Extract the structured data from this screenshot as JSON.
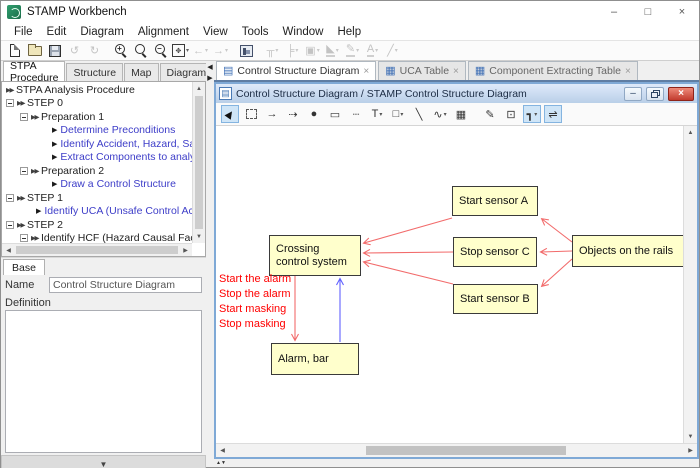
{
  "window": {
    "title": "STAMP Workbench"
  },
  "menubar": {
    "items": [
      "File",
      "Edit",
      "Diagram",
      "Alignment",
      "View",
      "Tools",
      "Window",
      "Help"
    ]
  },
  "left_panel": {
    "tabs": [
      "STPA Procedure",
      "Structure",
      "Map",
      "Diagram"
    ],
    "active_tab": "STPA Procedure",
    "tree": {
      "items": [
        {
          "label": "STPA Analysis Procedure"
        },
        {
          "label": "STEP 0"
        },
        {
          "label": "Preparation 1"
        },
        {
          "label": "Determine Preconditions"
        },
        {
          "label": "Identify Accident, Hazard, Safety Co"
        },
        {
          "label": "Extract Components to analyze"
        },
        {
          "label": "Preparation 2"
        },
        {
          "label": "Draw a Control Structure"
        },
        {
          "label": "STEP 1"
        },
        {
          "label": "Identify UCA (Unsafe Control Action)"
        },
        {
          "label": "STEP 2"
        },
        {
          "label": "Identify HCF (Hazard Causal Factor)"
        }
      ]
    },
    "base": {
      "tab_label": "Base",
      "name_label": "Name",
      "name_value": "Control Structure Diagram",
      "definition_label": "Definition",
      "definition_value": ""
    }
  },
  "editor": {
    "tabs": [
      {
        "label": "Control Structure Diagram"
      },
      {
        "label": "UCA Table"
      },
      {
        "label": "Component Extracting Table"
      }
    ],
    "active_tab": "Control Structure Diagram",
    "window_title": "Control Structure Diagram / STAMP Control Structure Diagram",
    "diagram": {
      "nodes": [
        {
          "id": "crossing-control-system",
          "label": "Crossing control system"
        },
        {
          "id": "alarm-bar",
          "label": "Alarm, bar"
        },
        {
          "id": "start-sensor-a",
          "label": "Start sensor A"
        },
        {
          "id": "stop-sensor-c",
          "label": "Stop sensor C"
        },
        {
          "id": "start-sensor-b",
          "label": "Start sensor B"
        },
        {
          "id": "objects-on-the-rails",
          "label": "Objects on the rails"
        }
      ],
      "control_action_labels": [
        "Start the alarm",
        "Stop the alarm",
        "Start masking",
        "Stop masking"
      ],
      "edges": [
        {
          "from": "objects-on-the-rails",
          "to": "start-sensor-a",
          "color": "red"
        },
        {
          "from": "objects-on-the-rails",
          "to": "stop-sensor-c",
          "color": "red"
        },
        {
          "from": "objects-on-the-rails",
          "to": "start-sensor-b",
          "color": "red"
        },
        {
          "from": "start-sensor-a",
          "to": "crossing-control-system",
          "color": "red"
        },
        {
          "from": "stop-sensor-c",
          "to": "crossing-control-system",
          "color": "red"
        },
        {
          "from": "start-sensor-b",
          "to": "crossing-control-system",
          "color": "red"
        },
        {
          "from": "crossing-control-system",
          "to": "alarm-bar",
          "color": "red"
        },
        {
          "from": "alarm-bar",
          "to": "crossing-control-system",
          "color": "blue"
        }
      ],
      "colors": {
        "node_fill": "#ffffcc",
        "control_red": "#f26b6b",
        "label_red": "#ff0000",
        "feedback_blue": "#6060ff"
      }
    }
  }
}
